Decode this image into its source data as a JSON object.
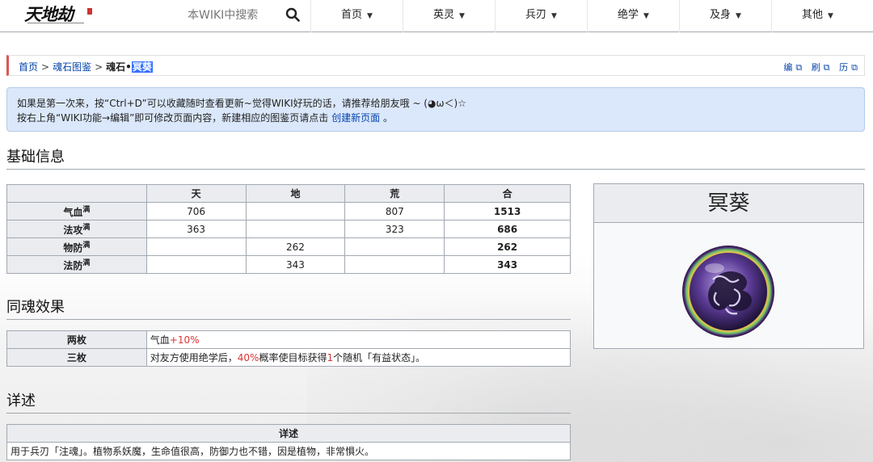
{
  "site": {
    "logo_text": "天地劫",
    "search_placeholder": "本WIKI中搜索",
    "nav": [
      {
        "label": "首页"
      },
      {
        "label": "英灵"
      },
      {
        "label": "兵刃"
      },
      {
        "label": "绝学"
      },
      {
        "label": "及身"
      },
      {
        "label": "其他"
      }
    ]
  },
  "breadcrumb": {
    "home": "首页",
    "sep": ">",
    "category": "魂石图鉴",
    "current_prefix": "魂石•",
    "current_highlight": "冥葵",
    "tools": [
      "编",
      "刷",
      "历"
    ]
  },
  "notice": {
    "line1": "如果是第一次来，按“Ctrl+D”可以收藏随时查看更新~觉得WIKI好玩的话，请推荐给朋友哦 ~ (◕ω＜)☆",
    "line2_prefix": "按右上角“WIKI功能→编辑”即可修改页面内容，新建相应的图鉴页请点击 ",
    "line2_link": "创建新页面",
    "line2_suffix": " 。"
  },
  "sections": {
    "basic": "基础信息",
    "resonance": "同魂效果",
    "detail": "详述"
  },
  "stats_table": {
    "headers": [
      "",
      "天",
      "地",
      "荒",
      "合"
    ],
    "sup": "满",
    "rows": [
      {
        "label": "气血",
        "tian": "706",
        "di": "",
        "huang": "807",
        "total": "1513"
      },
      {
        "label": "法攻",
        "tian": "363",
        "di": "",
        "huang": "323",
        "total": "686"
      },
      {
        "label": "物防",
        "tian": "",
        "di": "262",
        "huang": "",
        "total": "262"
      },
      {
        "label": "法防",
        "tian": "",
        "di": "343",
        "huang": "",
        "total": "343"
      }
    ]
  },
  "set_table": {
    "rows": [
      {
        "label": "两枚",
        "pre": "气血",
        "red1": "+10%",
        "mid": "",
        "red2": "",
        "post": ""
      },
      {
        "label": "三枚",
        "pre": "对友方使用绝学后，",
        "red1": "40%",
        "mid": "概率使目标获得",
        "red2": "1",
        "post": "个随机「有益状态」。"
      }
    ]
  },
  "detail_table": {
    "header": "详述",
    "text": "用于兵刃「注魂」。植物系妖魔，生命值很高，防御力也不错，因是植物，非常惧火。"
  },
  "infobox": {
    "title": "冥葵",
    "image": "soul-stone-purple-flower"
  },
  "colors": {
    "link": "#0645ad",
    "accent_red": "#d33",
    "notice_bg": "#dbe8fb",
    "table_header": "#eaecf0"
  }
}
